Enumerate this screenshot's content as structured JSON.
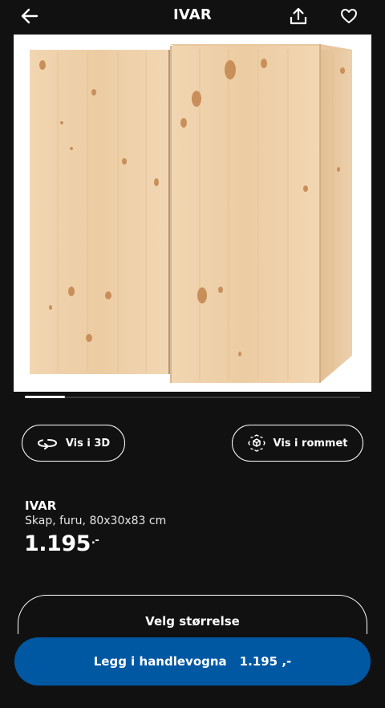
{
  "header": {
    "title": "IVAR",
    "back_icon": "arrow-left-icon",
    "share_icon": "share-icon",
    "favourite_icon": "heart-icon"
  },
  "gallery": {
    "image_alt": "IVAR wooden cabinet",
    "progress_fraction": 0.12
  },
  "actions": {
    "view_3d_label": "Vis i 3D",
    "view_3d_icon": "rotate-3d-icon",
    "view_room_label": "Vis i rommet",
    "view_room_icon": "ar-cube-icon"
  },
  "product": {
    "name": "IVAR",
    "description": "Skap, furu, 80x30x83 cm",
    "price": "1.195",
    "price_suffix": ".-"
  },
  "size_button": {
    "label": "Velg størrelse"
  },
  "cart": {
    "label": "Legg i handlevogna",
    "price": "1.195 ,-"
  },
  "colors": {
    "background": "#111111",
    "cart_button": "#0058a3",
    "text": "#ffffff",
    "wood": "#efd2ab"
  }
}
